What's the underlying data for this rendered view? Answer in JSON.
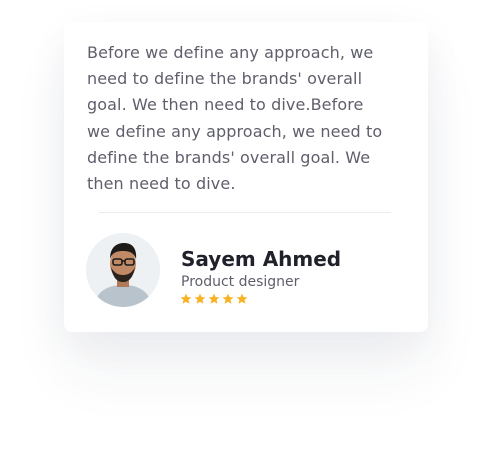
{
  "testimonial": {
    "quote": "Before we define any approach, we need to define the brands' overall goal. We then need to dive.Before we define any approach, we need to define the brands' overall goal. We then need to dive.",
    "author": {
      "name": "Sayem Ahmed",
      "role": "Product designer",
      "rating": 5,
      "rating_max": 5
    }
  },
  "colors": {
    "text": "#5e5f6b",
    "heading": "#20212b",
    "star": "#f8b324",
    "divider": "#ececf0"
  },
  "icons": {
    "rating": "star-icon"
  }
}
